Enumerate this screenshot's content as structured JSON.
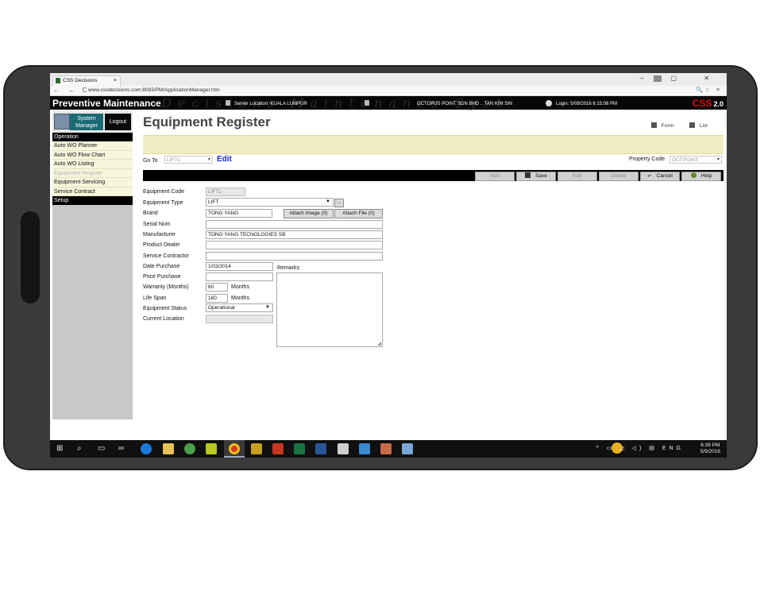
{
  "browser": {
    "tab_title": "CSS Decisions",
    "tab_close": "×",
    "url": "www.cssdecisions.com:8083/PM/ApplicationManager.htm",
    "nav": "← → C",
    "win_controls": "– ▢ ✕",
    "url_icons": "🔍☆ ≡"
  },
  "header": {
    "app_title": "Preventive Maintenance",
    "watermark": "Decisions Maintenance Syst",
    "server_location": "Server Location: KUALA LUMPUR",
    "company": "OCTOPUS POINT SDN BHD",
    "user": "TAN KIM SIN",
    "login": "Login: 5/09/2016 6:15:08 PM",
    "logo": "CSS",
    "version": "2.0"
  },
  "sidebar": {
    "system_manager": "System Manager",
    "logout": "Logout",
    "sections": [
      {
        "title": "Operation",
        "items": [
          {
            "label": "Auto WO Planner",
            "disabled": false
          },
          {
            "label": "Auto WO Flow Chart",
            "disabled": false
          },
          {
            "label": "Auto WO Listing",
            "disabled": false
          },
          {
            "label": "Equipment Register",
            "disabled": true
          },
          {
            "label": "Equipment Servicing",
            "disabled": false
          },
          {
            "label": "Service Contract",
            "disabled": false
          }
        ]
      },
      {
        "title": "Setup",
        "items": []
      }
    ]
  },
  "main": {
    "title": "Equipment Register",
    "view_form": "Form",
    "view_list": "List",
    "goto_label": "Go To",
    "goto_value": "LIFT1",
    "mode": "Edit",
    "property_label": "Property Code",
    "property_value": "OCTPOINT",
    "toolbar": {
      "add": "Add",
      "save": "Save",
      "edit": "Edit",
      "delete": "Delete",
      "cancel": "Cancel",
      "help": "Help"
    }
  },
  "form": {
    "labels": {
      "equipment_code": "Equipment Code",
      "equipment_type": "Equipment Type",
      "brand": "Brand",
      "serial_num": "Serial Num",
      "manufacturer": "Manufacturer",
      "product_dealer": "Product Dealer",
      "service_contractor": "Service Contractor",
      "date_purchase": "Date Purchase",
      "price_purchase": "Price Purchase",
      "warranty": "Warranty (Months)",
      "life_span": "Life Span",
      "equipment_status": "Equipment Status",
      "current_location": "Current Location",
      "remarks": "Remarks"
    },
    "values": {
      "equipment_code": "LIFT1",
      "equipment_type": "LIFT",
      "brand": "TONG YANG",
      "serial_num": "",
      "manufacturer": "TONG YANG TECNOLOGIES SB",
      "product_dealer": "",
      "service_contractor": "",
      "date_purchase": "1/03/2014",
      "price_purchase": "",
      "warranty": "60",
      "life_span": "180",
      "equipment_status": "Operational",
      "current_location": "",
      "remarks": ""
    },
    "units": {
      "months": "Months"
    },
    "lookup_button": "...",
    "attach_image": "Attach Image (0)",
    "attach_file": "Attach File (0)"
  },
  "taskbar": {
    "tray": "^ ▭ ◿ ◁) ▤ ENG",
    "time": "6:39 PM",
    "date": "5/9/2016"
  },
  "colors": {
    "toolbar_band": "#000000",
    "message_band": "#f1ecc4",
    "sidebar_item_bg": "#f7f6dc",
    "system_manager_bg": "#1a6a74",
    "edit_mode": "#1a2ad0",
    "logo_red": "#e01010"
  }
}
